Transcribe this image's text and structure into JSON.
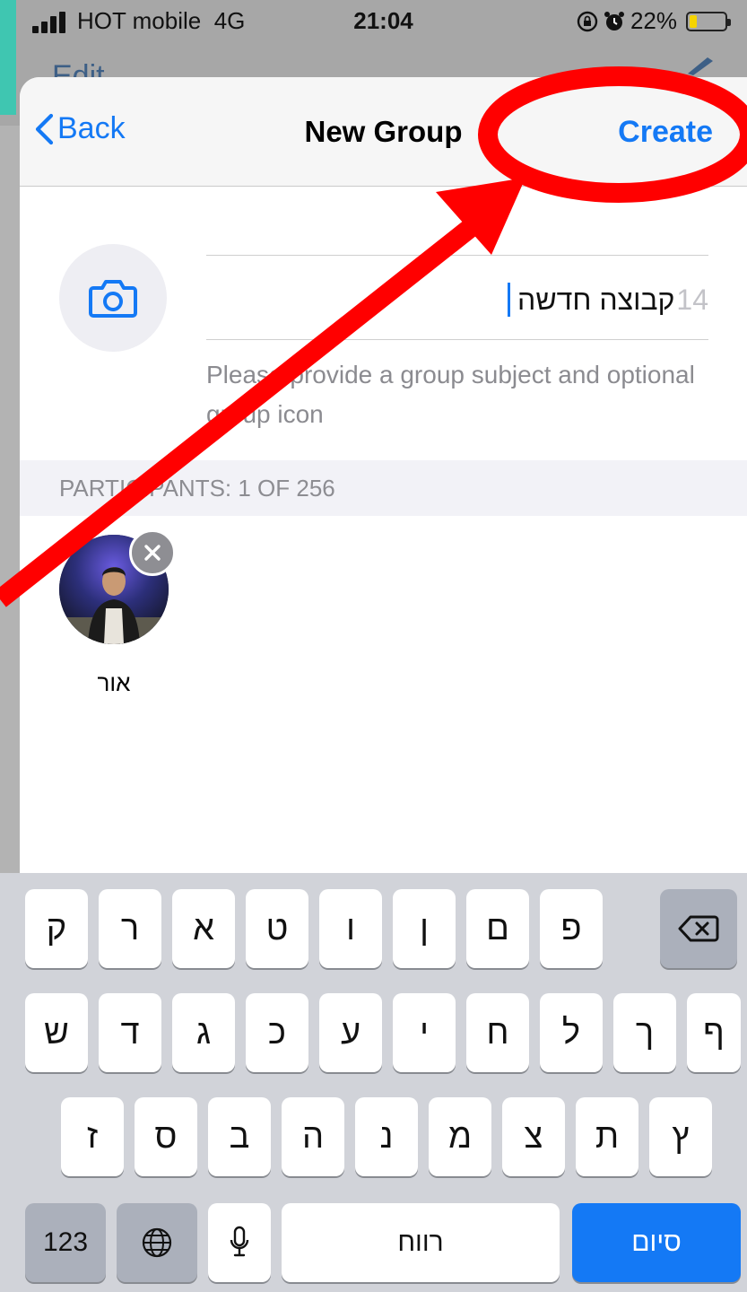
{
  "background_app": {
    "edit_label": "Edit"
  },
  "status_bar": {
    "carrier": "HOT mobile",
    "network": "4G",
    "time": "21:04",
    "battery_percent": "22%",
    "battery_level": 0.22
  },
  "nav": {
    "back_label": "Back",
    "title": "New Group",
    "create_label": "Create"
  },
  "subject": {
    "value": "קבוצה חדשה",
    "char_count": "14",
    "hint": "Please provide a group subject and optional group icon"
  },
  "participants": {
    "header": "PARTICIPANTS: 1 OF 256",
    "items": [
      {
        "name": "אור"
      }
    ]
  },
  "keyboard": {
    "row1": [
      "ק",
      "ר",
      "א",
      "ט",
      "ו",
      "ן",
      "ם",
      "פ"
    ],
    "row2": [
      "ש",
      "ד",
      "ג",
      "כ",
      "ע",
      "י",
      "ח",
      "ל",
      "ך",
      "ף"
    ],
    "row3": [
      "ז",
      "ס",
      "ב",
      "ה",
      "נ",
      "מ",
      "צ",
      "ת",
      "ץ"
    ],
    "numbers_label": "123",
    "space_label": "רווח",
    "done_label": "סיום"
  },
  "colors": {
    "accent": "#1479f5",
    "annotation": "#ff0000",
    "app_teal": "#3fc6b1"
  },
  "icons": {
    "camera": "camera-icon",
    "remove": "close-icon",
    "globe": "globe-icon",
    "mic": "microphone-icon",
    "backspace": "backspace-icon"
  }
}
